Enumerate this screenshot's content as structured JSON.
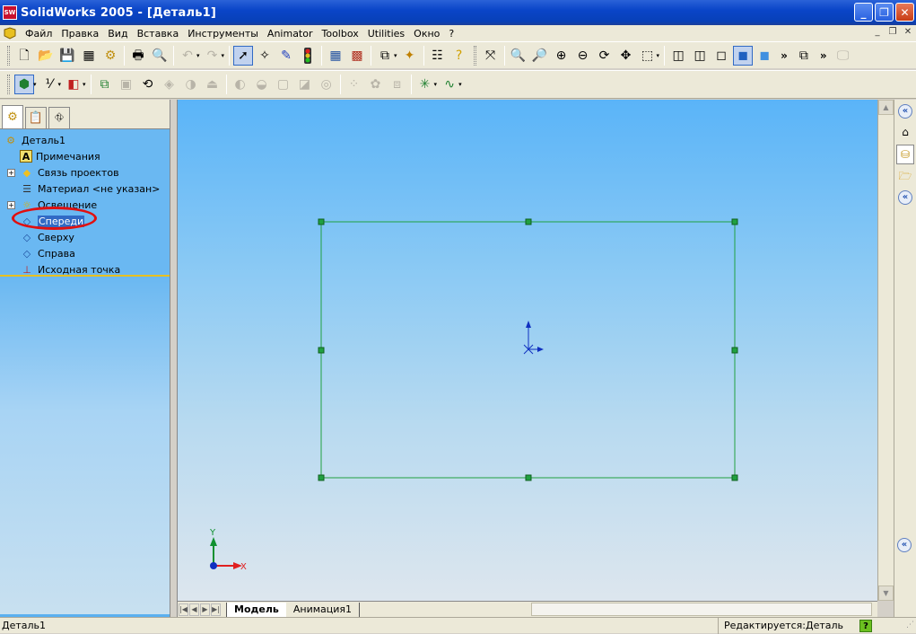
{
  "window": {
    "title": "SolidWorks 2005 - [Деталь1]",
    "app_icon_text": "SW",
    "buttons": {
      "minimize": "_",
      "restore": "❐",
      "close": "✕"
    }
  },
  "menu": {
    "items": [
      "Файл",
      "Правка",
      "Вид",
      "Вставка",
      "Инструменты",
      "Animator",
      "Toolbox",
      "Utilities",
      "Окно",
      "?"
    ],
    "mdi_buttons": [
      "_",
      "❐",
      "✕"
    ]
  },
  "feature_tree": {
    "items": [
      {
        "label": "Деталь1",
        "icon": "part-icon",
        "glyph": "⚙",
        "expandable": false,
        "selected": false
      },
      {
        "label": "Примечания",
        "icon": "annotations-icon",
        "glyph": "A",
        "expandable": false,
        "selected": false
      },
      {
        "label": "Связь проектов",
        "icon": "design-binder-icon",
        "glyph": "◆",
        "expandable": true,
        "selected": false
      },
      {
        "label": "Материал <не указан>",
        "icon": "material-icon",
        "glyph": "☰",
        "expandable": false,
        "selected": false
      },
      {
        "label": "Освещение",
        "icon": "lighting-icon",
        "glyph": "☼",
        "expandable": true,
        "selected": false
      },
      {
        "label": "Спереди",
        "icon": "plane-icon",
        "glyph": "◇",
        "expandable": false,
        "selected": true
      },
      {
        "label": "Сверху",
        "icon": "plane-icon",
        "glyph": "◇",
        "expandable": false,
        "selected": false
      },
      {
        "label": "Справа",
        "icon": "plane-icon",
        "glyph": "◇",
        "expandable": false,
        "selected": false
      },
      {
        "label": "Исходная точка",
        "icon": "origin-icon",
        "glyph": "⊥",
        "expandable": false,
        "selected": false
      }
    ],
    "expand_glyph": "+"
  },
  "graphics": {
    "triad": {
      "x_label": "X",
      "y_label": "Y"
    }
  },
  "bottom_tabs": {
    "model": "Модель",
    "animation": "Анимация1",
    "nav": [
      "|◀",
      "◀",
      "▶",
      "▶|"
    ]
  },
  "status": {
    "left": "Деталь1",
    "right": "Редактируется:Деталь",
    "help": "?"
  },
  "colors": {
    "title_bar": "#0a45c8",
    "sketch_lines": "#20a040",
    "selection_highlight": "#e01010",
    "axis_x": "#e02020",
    "axis_y": "#109030"
  }
}
